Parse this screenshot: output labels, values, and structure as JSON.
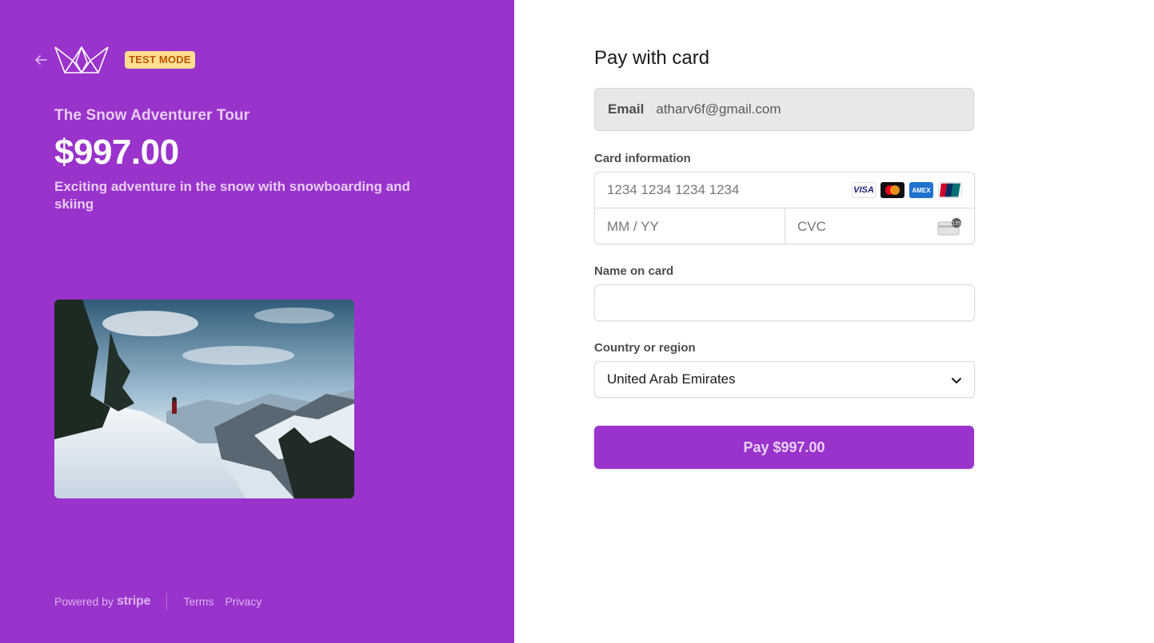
{
  "colors": {
    "brand": "#9933cc",
    "badge_bg": "#ffde92",
    "badge_text": "#bb5504"
  },
  "left": {
    "back_icon": "arrow-left-icon",
    "logo_icon": "crown-logo-icon",
    "test_mode_badge": "TEST MODE",
    "product_name": "The Snow Adventurer Tour",
    "price": "$997.00",
    "description": "Exciting adventure in the snow with snowboarding and skiing",
    "image_icon": "snowy-mountain-photo",
    "footer": {
      "powered_by": "Powered by",
      "stripe": "stripe",
      "terms": "Terms",
      "privacy": "Privacy"
    }
  },
  "form": {
    "title": "Pay with card",
    "email": {
      "label": "Email",
      "value": "atharv6f@gmail.com"
    },
    "card": {
      "label": "Card information",
      "number_placeholder": "1234 1234 1234 1234",
      "expiry_placeholder": "MM / YY",
      "cvc_placeholder": "CVC",
      "brands": [
        "VISA",
        "mastercard",
        "AMEX",
        "UnionPay"
      ],
      "cvc_icon": "card-cvc-icon",
      "cvc_digits": "135"
    },
    "name": {
      "label": "Name on card",
      "value": ""
    },
    "country": {
      "label": "Country or region",
      "selected": "United Arab Emirates"
    },
    "pay_button": "Pay $997.00"
  }
}
